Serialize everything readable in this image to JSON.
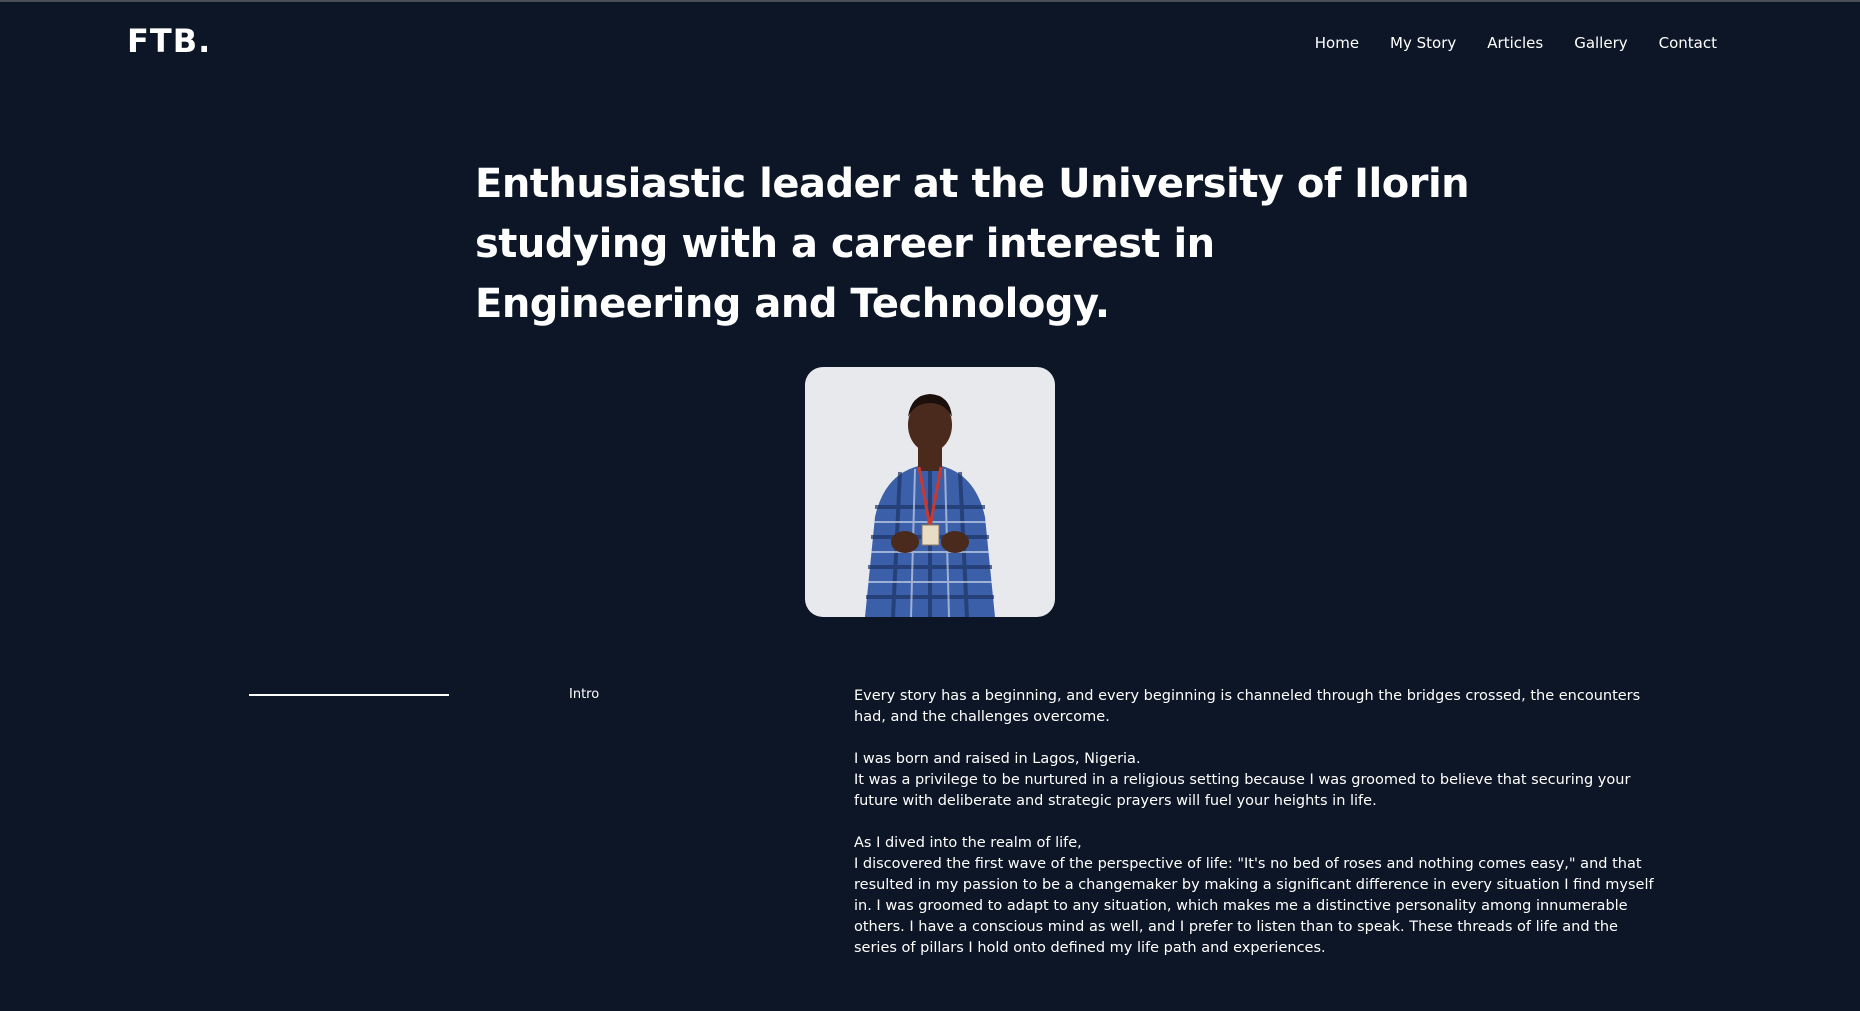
{
  "header": {
    "logo": "FTB.",
    "nav": [
      {
        "label": "Home"
      },
      {
        "label": "My Story"
      },
      {
        "label": "Articles"
      },
      {
        "label": "Gallery"
      },
      {
        "label": "Contact"
      }
    ]
  },
  "hero": {
    "heading": "Enthusiastic leader at the University of Ilorin studying with a career interest in Engineering and Technology."
  },
  "intro": {
    "label": "Intro",
    "paragraphs": [
      [
        "Every story has a beginning, and every beginning is channeled through the bridges crossed, the encounters had, and the challenges overcome."
      ],
      [
        "I was born and raised in Lagos, Nigeria.",
        "It was a privilege to be nurtured in a religious setting because I was groomed to believe that securing your future with deliberate and strategic prayers will fuel your heights in life."
      ],
      [
        "As I dived into the realm of life,",
        "I discovered the first wave of the perspective of life: \"It's no bed of roses and nothing comes easy,\" and that resulted in my passion to be a changemaker by making a significant difference in every situation I find myself in. I was groomed to adapt to any situation, which makes me a distinctive personality among innumerable others. I have a conscious mind as well, and I prefer to listen than to speak. These threads of life and the series of pillars I hold onto defined my life path and experiences."
      ]
    ]
  },
  "colors": {
    "background": "#0d1627",
    "text": "#ffffff",
    "portrait_bg": "#e8e9ec"
  }
}
